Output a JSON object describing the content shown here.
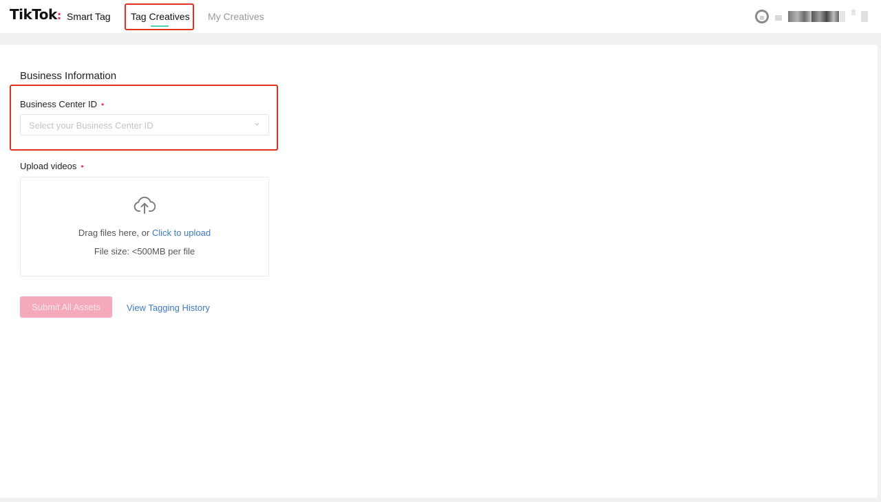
{
  "header": {
    "logo_text": "TikTok",
    "logo_dot": ":",
    "product_name": "Smart Tag",
    "tabs": [
      {
        "label": "Tag Creatives",
        "active": true
      },
      {
        "label": "My Creatives",
        "active": false
      }
    ]
  },
  "form": {
    "section_title": "Business Information",
    "business_center": {
      "label": "Business Center ID",
      "required_mark": "•",
      "placeholder": "Select your Business Center ID",
      "icon": "chevron-down-icon"
    },
    "upload": {
      "label": "Upload videos",
      "required_mark": "•",
      "icon": "cloud-upload-icon",
      "hint_prefix": "Drag files here, or ",
      "hint_link": "Click to upload",
      "file_size": "File size: <500MB per file"
    },
    "submit_label": "Submit All Assets",
    "history_label": "View Tagging History"
  },
  "colors": {
    "brand_accent": "#fe2c55",
    "link": "#3a7bd5",
    "tab_underline": "#4fd1b9",
    "highlight_box": "#e0311f",
    "submit_disabled_bg": "#f6a9bb"
  }
}
